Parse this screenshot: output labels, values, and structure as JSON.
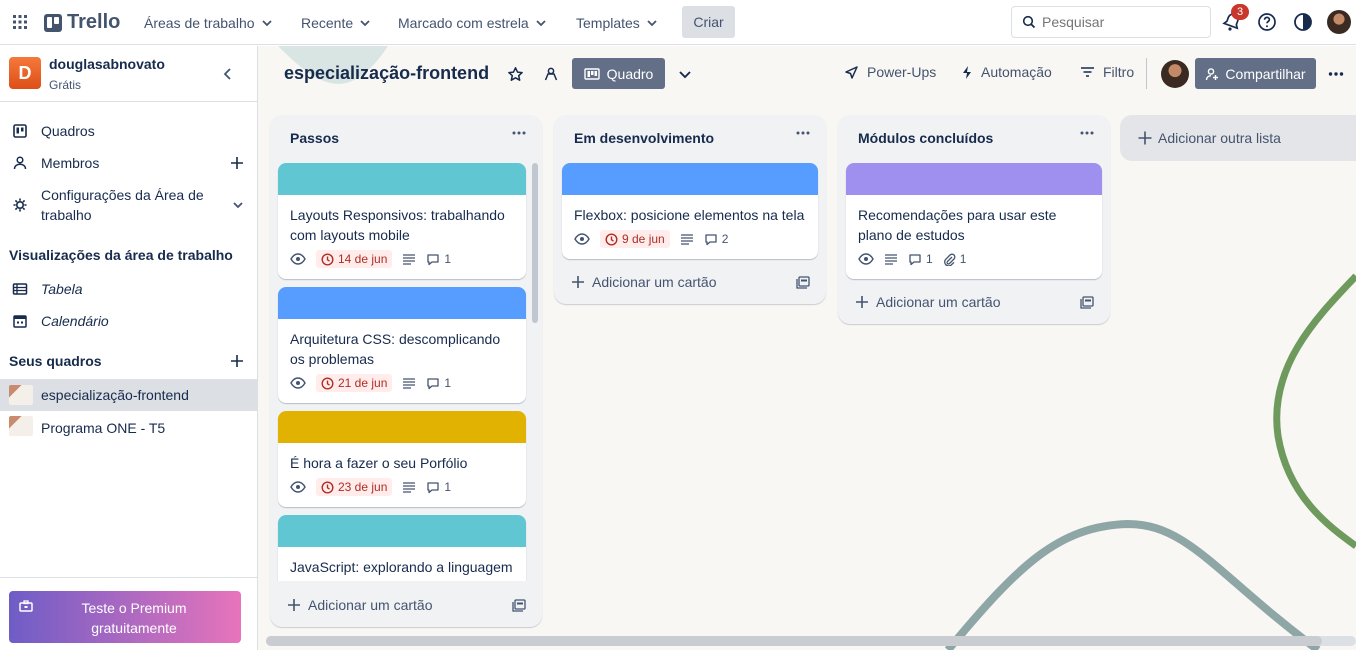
{
  "topbar": {
    "logo": "Trello",
    "nav": [
      {
        "label": "Áreas de trabalho"
      },
      {
        "label": "Recente"
      },
      {
        "label": "Marcado com estrela"
      },
      {
        "label": "Templates"
      }
    ],
    "create_label": "Criar",
    "search_placeholder": "Pesquisar",
    "notifications_count": "3"
  },
  "sidebar": {
    "workspace_initial": "D",
    "workspace_name": "douglasabnovato",
    "workspace_plan": "Grátis",
    "items": [
      {
        "label": "Quadros",
        "icon": "board-icon"
      },
      {
        "label": "Membros",
        "icon": "person-icon"
      },
      {
        "label": "Configurações da Área de trabalho",
        "icon": "gear-icon"
      }
    ],
    "views_title": "Visualizações da área de trabalho",
    "views": [
      {
        "label": "Tabela",
        "icon": "table-icon"
      },
      {
        "label": "Calendário",
        "icon": "calendar-icon"
      }
    ],
    "boards_title": "Seus quadros",
    "boards": [
      {
        "label": "especialização-frontend",
        "active": true
      },
      {
        "label": "Programa ONE - T5",
        "active": false
      }
    ],
    "premium_label": "Teste o Premium gratuitamente"
  },
  "board": {
    "title": "especialização-frontend",
    "view_label": "Quadro",
    "powerups_label": "Power-Ups",
    "automation_label": "Automação",
    "filter_label": "Filtro",
    "share_label": "Compartilhar",
    "add_list_label": "Adicionar outra lista",
    "add_card_label": "Adicionar um cartão",
    "lists": [
      {
        "title": "Passos",
        "cards": [
          {
            "title": "Layouts Responsivos: trabalhando com layouts mobile",
            "cover": "#60c6d2",
            "due": "14 de jun",
            "comments": "1"
          },
          {
            "title": "Arquitetura CSS: descomplicando os problemas",
            "cover": "#579dff",
            "due": "21 de jun",
            "comments": "1"
          },
          {
            "title": "É hora a fazer o seu Porfólio",
            "cover": "#e2b203",
            "due": "23 de jun",
            "comments": "1"
          },
          {
            "title": "JavaScript: explorando a linguagem",
            "cover": "#60c6d2"
          }
        ]
      },
      {
        "title": "Em desenvolvimento",
        "cards": [
          {
            "title": "Flexbox: posicione elementos na tela",
            "cover": "#579dff",
            "due": "9 de jun",
            "comments": "2"
          }
        ]
      },
      {
        "title": "Módulos concluídos",
        "cards": [
          {
            "title": "Recomendações para usar este plano de estudos",
            "cover": "#9f8fef",
            "comments": "1",
            "attachments": "1"
          }
        ]
      }
    ]
  }
}
